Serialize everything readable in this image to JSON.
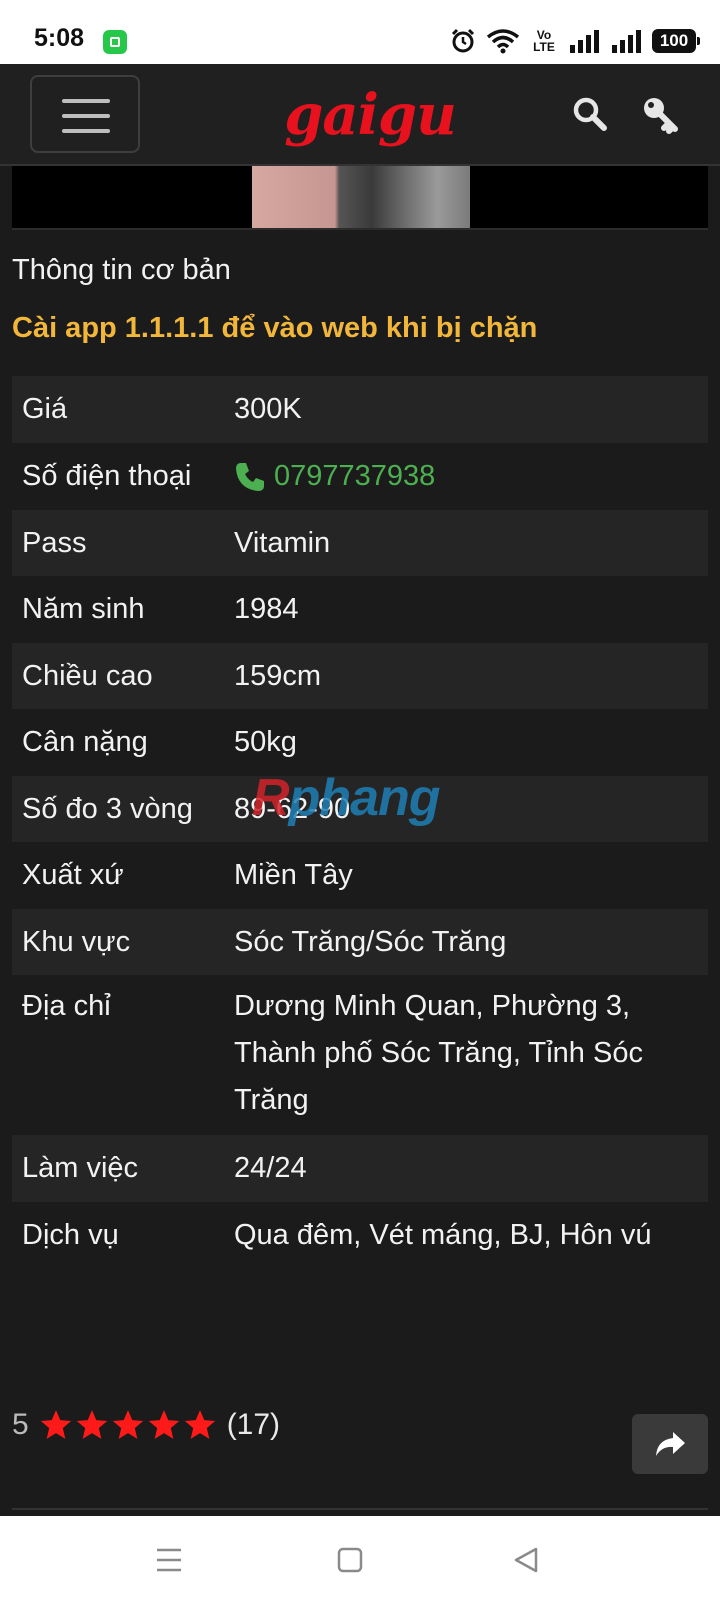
{
  "status_bar": {
    "time": "5:08",
    "network": "Vo LTE",
    "battery": "100"
  },
  "header": {
    "logo": "gaigu"
  },
  "section": {
    "title": "Thông tin cơ bản",
    "promo": "Cài app 1.1.1.1 để vào web khi bị chặn"
  },
  "info": {
    "rows": [
      {
        "label": "Giá",
        "value": "300K"
      },
      {
        "label": "Số điện thoại",
        "value": "0797737938"
      },
      {
        "label": "Pass",
        "value": "Vitamin"
      },
      {
        "label": "Năm sinh",
        "value": "1984"
      },
      {
        "label": "Chiều cao",
        "value": "159cm"
      },
      {
        "label": "Cân nặng",
        "value": "50kg"
      },
      {
        "label": "Số đo 3 vòng",
        "value": "89-62-90"
      },
      {
        "label": "Xuất xứ",
        "value": "Miền Tây"
      },
      {
        "label": "Khu vực",
        "value": "Sóc Trăng/Sóc Trăng"
      },
      {
        "label": "Địa chỉ",
        "value": "Dương Minh Quan, Phường 3, Thành phố Sóc Trăng, Tỉnh Sóc Trăng"
      },
      {
        "label": "Làm việc",
        "value": "24/24"
      },
      {
        "label": "Dịch vụ",
        "value": "Qua đêm, Vét máng, BJ, Hôn vú"
      }
    ]
  },
  "watermark": {
    "first": "R",
    "rest": "phang"
  },
  "rating": {
    "score": "5",
    "stars": 5,
    "count": "(17)"
  },
  "colors": {
    "accent_red": "#e8121f",
    "promo_yellow": "#f2b73a",
    "phone_green": "#4caf50",
    "star_red": "#ff1a1a"
  }
}
